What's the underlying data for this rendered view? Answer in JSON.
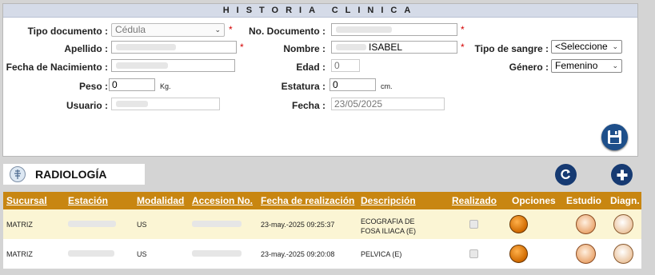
{
  "form": {
    "title": "HISTORIA CLINICA",
    "labels": {
      "tipo_documento": "Tipo documento :",
      "no_documento": "No. Documento :",
      "apellido": "Apellido :",
      "nombre": "Nombre :",
      "tipo_sangre": "Tipo de sangre :",
      "fecha_nacimiento": "Fecha de Nacimiento :",
      "edad": "Edad :",
      "genero": "Género :",
      "peso": "Peso :",
      "estatura": "Estatura :",
      "usuario": "Usuario :",
      "fecha": "Fecha :"
    },
    "values": {
      "tipo_documento": "Cédula",
      "no_documento": "",
      "apellido": "",
      "nombre": "ISABEL",
      "tipo_sangre": "<Seleccione",
      "fecha_nacimiento": "",
      "edad": "0",
      "genero": "Femenino",
      "peso": "0",
      "estatura": "0",
      "usuario": "",
      "fecha": "23/05/2025"
    },
    "units": {
      "peso": "Kg.",
      "estatura": "cm."
    },
    "required_mark": "*",
    "save_icon": "floppy-disk-icon"
  },
  "radiologia": {
    "title": "RADIOLOGÍA",
    "refresh_icon": "refresh-icon",
    "add_icon": "plus-icon",
    "columns": [
      "Sucursal",
      "Estación",
      "Modalidad",
      "Accesion No.",
      "Fecha de realización",
      "Descripción",
      "Realizado",
      "Opciones",
      "Estudio",
      "Diagn."
    ],
    "rows": [
      {
        "sucursal": "MATRIZ",
        "estacion": "",
        "modalidad": "US",
        "accesion": "",
        "fecha": "23-may.-2025 09:25:37",
        "descripcion_1": "ECOGRAFIA DE",
        "descripcion_2": "FOSA ILIACA (E)",
        "realizado": true
      },
      {
        "sucursal": "MATRIZ",
        "estacion": "",
        "modalidad": "US",
        "accesion": "",
        "fecha": "23-may.-2025 09:20:08",
        "descripcion_1": "PELVICA (E)",
        "descripcion_2": "",
        "realizado": true
      }
    ],
    "colors": {
      "header_bg": "#c88611",
      "odd_row": "#fbf5d4",
      "button_dark_blue": "#163a72"
    }
  }
}
